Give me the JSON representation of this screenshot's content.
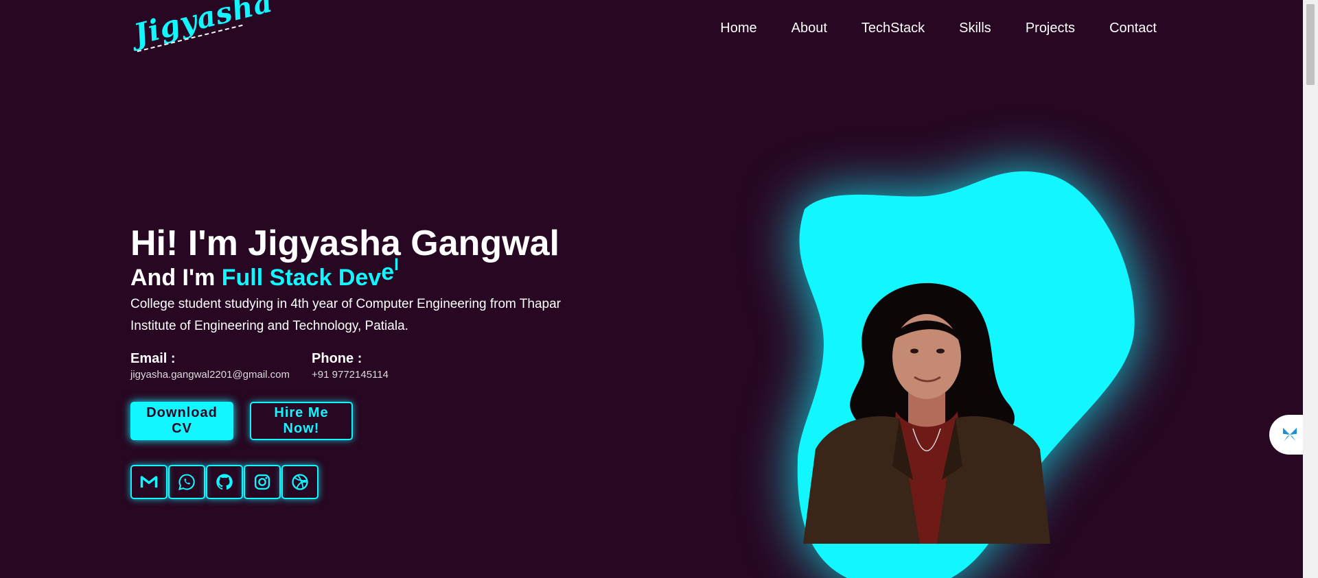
{
  "logo": {
    "text": "Jigyasha"
  },
  "nav": {
    "items": [
      "Home",
      "About",
      "TechStack",
      "Skills",
      "Projects",
      "Contact"
    ]
  },
  "hero": {
    "greeting": "Hi! I'm Jigyasha Gangwal",
    "role_prefix": "And I'm",
    "role_highlight": "Full Stack Dev",
    "role_animated": "el",
    "bio": "College student studying in 4th year of Computer Engineering from Thapar Institute of Engineering and Technology, Patiala.",
    "email_label": "Email :",
    "email_value": "jigyasha.gangwal2201@gmail.com",
    "phone_label": "Phone :",
    "phone_value": "+91 9772145114",
    "download_cv": "Download CV",
    "hire_me": "Hire Me Now!"
  },
  "social_icons": [
    "gmail-icon",
    "whatsapp-icon",
    "github-icon",
    "instagram-icon",
    "dribbble-icon"
  ],
  "colors": {
    "background": "#270722",
    "accent": "#12f7ff",
    "text": "#ffffff"
  }
}
